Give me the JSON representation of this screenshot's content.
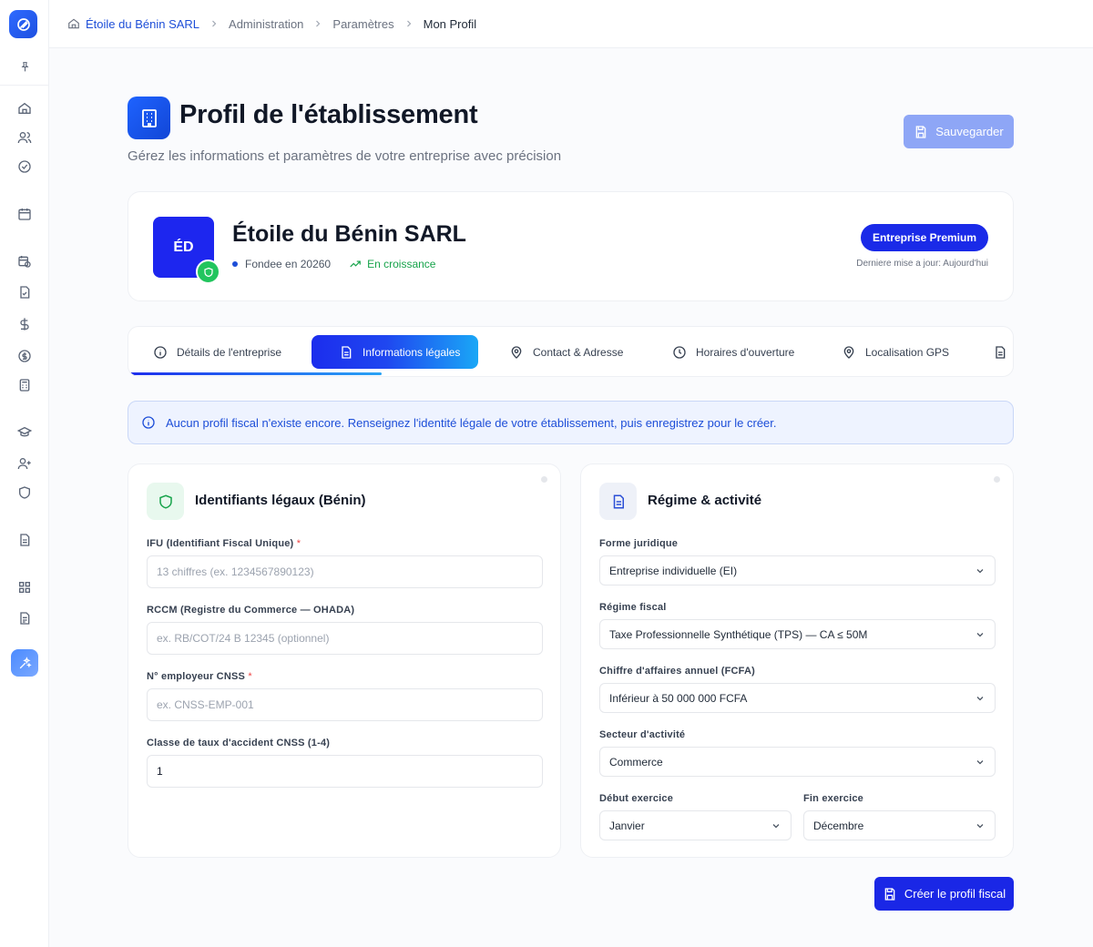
{
  "breadcrumb": {
    "items": [
      "Étoile du Bénin SARL",
      "Administration",
      "Paramètres",
      "Mon Profil"
    ]
  },
  "header": {
    "title": "Profil de l'établissement",
    "subtitle": "Gérez les informations et paramètres de votre entreprise avec précision",
    "save_label": "Sauvegarder"
  },
  "company": {
    "initials": "ÉD",
    "name": "Étoile du Bénin SARL",
    "founded": "Fondee en 20260",
    "growth": "En croissance",
    "badge": "Entreprise Premium",
    "updated": "Derniere mise a jour: Aujourd'hui"
  },
  "tabs": [
    {
      "label": "Détails de l'entreprise"
    },
    {
      "label": "Informations légales"
    },
    {
      "label": "Contact & Adresse"
    },
    {
      "label": "Horaires d'ouverture"
    },
    {
      "label": "Localisation GPS"
    }
  ],
  "alert": {
    "text": "Aucun profil fiscal n'existe encore. Renseignez l'identité légale de votre établissement, puis enregistrez pour le créer."
  },
  "legal_ids": {
    "title": "Identifiants légaux (Bénin)",
    "ifu_label": "IFU (Identifiant Fiscal Unique)",
    "ifu_placeholder": "13 chiffres (ex. 1234567890123)",
    "rccm_label": "RCCM (Registre du Commerce — OHADA)",
    "rccm_placeholder": "ex. RB/COT/24 B 12345 (optionnel)",
    "cnss_label": "N° employeur CNSS",
    "cnss_placeholder": "ex. CNSS-EMP-001",
    "rate_label": "Classe de taux d'accident CNSS (1-4)",
    "rate_value": "1",
    "required_mark": "*"
  },
  "regime": {
    "title": "Régime & activité",
    "forme_label": "Forme juridique",
    "forme_value": "Entreprise individuelle (EI)",
    "regime_label": "Régime fiscal",
    "regime_value": "Taxe Professionnelle Synthétique (TPS) — CA ≤ 50M",
    "ca_label": "Chiffre d'affaires annuel (FCFA)",
    "ca_value": "Inférieur à 50 000 000 FCFA",
    "secteur_label": "Secteur d'activité",
    "secteur_value": "Commerce",
    "debut_label": "Début exercice",
    "debut_value": "Janvier",
    "fin_label": "Fin exercice",
    "fin_value": "Décembre"
  },
  "actions": {
    "create_label": "Créer le profil fiscal"
  },
  "colors": {
    "primary": "#1a27e6",
    "accent_blue": "#1d4ed8",
    "success": "#22c55e",
    "save_disabled": "#8ea6f6"
  }
}
